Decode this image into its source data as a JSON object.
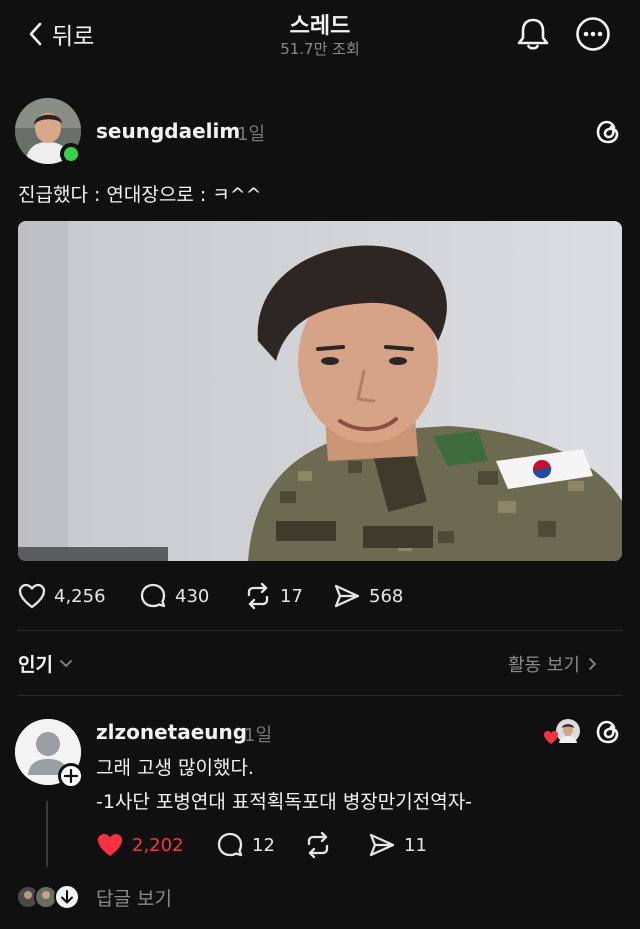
{
  "header": {
    "back_label": "뒤로",
    "title": "스레드",
    "subtitle": "51.7만 조회"
  },
  "post": {
    "author": "seungdaelim",
    "time": "1일",
    "caption": "진급했다 : 연대장으로 : ㅋ^^",
    "stats": {
      "likes": "4,256",
      "comments": "430",
      "reposts": "17",
      "shares": "568"
    }
  },
  "sort": {
    "label": "인기",
    "activity_label": "활동 보기"
  },
  "reply": {
    "author": "zlzonetaeung",
    "time": "1일",
    "line1": "그래 고생 많이했다.",
    "line2": "-1사단 포병연대 표적획독포대 병장만기전역자-",
    "stats": {
      "likes": "2,202",
      "comments": "12",
      "shares": "11"
    },
    "view_replies_label": "답글 보기"
  },
  "colors": {
    "background": "#101010",
    "like_red": "#ff3040",
    "online_green": "#36d14a",
    "muted_text": "#8a8a8a"
  }
}
